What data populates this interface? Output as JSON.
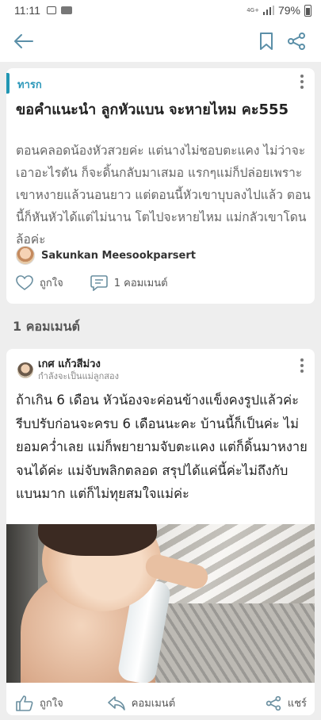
{
  "status": {
    "time": "11:11",
    "network": "4G+",
    "battery": "79%"
  },
  "appbar": {
    "back_icon": "arrow-left-icon",
    "bookmark_icon": "bookmark-icon",
    "share_icon": "share-icon"
  },
  "post": {
    "tag": "ทารก",
    "title": "ขอคำแนะนำ ลูกหัวแบน จะหายไหม คะ555",
    "body": "ตอนคลอดน้องหัวสวยค่ะ แต่นางไม่ชอบตะแคง ไม่ว่าจะเอาอะไรดัน ก็จะดิ้นกลับมาเสมอ แรกๆแม่ก็ปล่อยเพราะเขาหงายแล้วนอนยาว แต่ตอนนี้หัวเขาบุบลงไปแล้ว ตอนนี้ก็หันหัวได้แต่ไม่นาน โตไปจะหายไหม แม่กลัวเขาโดนล้อค่ะ",
    "author": "Sakunkan Meesookparsert",
    "like_label": "ถูกใจ",
    "comment_label": "1 คอมเมนต์"
  },
  "comments_header": "1 คอมเมนต์",
  "comment": {
    "author": "เกศ แก้วสีม่วง",
    "subtitle": "กำลังจะเป็นแม่ลูกสอง",
    "body": "ถ้าเกิน 6 เดือน หัวน้องจะค่อนข้างแข็งคงรูปแล้วค่ะ รีบปรับก่อนจะครบ 6 เดือนนะคะ บ้านนี้ก็เป็นค่ะ ไม่ยอมคว่ำเลย แม่ก็พยายามจับตะแคง แต่ก็ดิ้นมาหงายจนได้ค่ะ แม่จับพลิกตลอด สรุปได้แค่นี้ค่ะไม่ถึงกับแบนมาก แต่ก็ไม่ทุยสมใจแม่ค่ะ",
    "like_label": "ถูกใจ",
    "reply_label": "คอมเมนต์",
    "share_label": "แชร์"
  }
}
